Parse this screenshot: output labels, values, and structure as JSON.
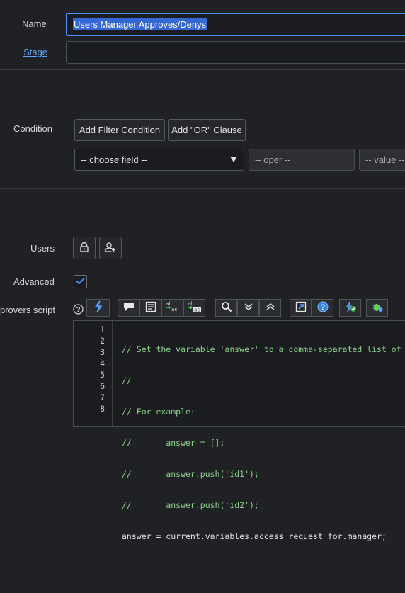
{
  "name": {
    "label": "Name",
    "value": "Users Manager Approves/Denys"
  },
  "stage": {
    "label": "Stage",
    "value": ""
  },
  "condition": {
    "label": "Condition",
    "add_filter_label": "Add Filter Condition",
    "add_or_label": "Add \"OR\" Clause",
    "field_select": "-- choose field --",
    "oper_select": "-- oper --",
    "value_select": "-- value --"
  },
  "users": {
    "label": "Users"
  },
  "advanced": {
    "label": "Advanced",
    "checked": true
  },
  "approvers_script": {
    "label": "provers script",
    "line_numbers": [
      "1",
      "2",
      "3",
      "4",
      "5",
      "6",
      "7",
      "8"
    ],
    "lines": [
      "// Set the variable 'answer' to a comma-separated list of use",
      "//",
      "// For example:",
      "//       answer = [];",
      "//       answer.push('id1');",
      "//       answer.push('id2');",
      "answer = current.variables.access_request_for.manager;",
      ""
    ]
  },
  "icons": {
    "help": "help-icon",
    "format": "format-code-icon",
    "comment": "comment-icon",
    "doc": "document-icon",
    "replace": "replace-icon",
    "replace_all": "replace-all-icon",
    "search": "search-icon",
    "expand": "expand-all-icon",
    "collapse": "collapse-all-icon",
    "fullscreen": "fullscreen-icon",
    "help2": "script-help-icon",
    "syntax": "syntax-check-icon",
    "debug": "script-debugger-icon",
    "lock": "lock-icon",
    "add_user": "add-user-icon",
    "check": "checkmark-icon"
  },
  "colors": {
    "accent": "#4a90ff",
    "selection": "#3568d4",
    "comment": "#8ccf8c",
    "link": "#63a4ff"
  }
}
